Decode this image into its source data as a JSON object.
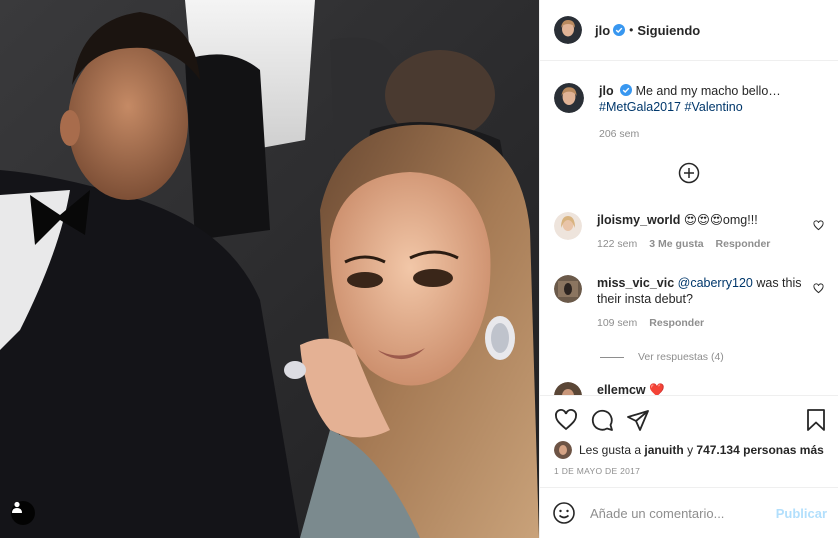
{
  "post": {
    "author": "jlo",
    "follow_status": "Siguiendo",
    "separator": "•"
  },
  "caption": {
    "user": "jlo",
    "text": "Me and my macho bello…",
    "hashtag1": "#MetGala2017",
    "hashtag2": "#Valentino",
    "time": "206 sem"
  },
  "comments": [
    {
      "user": "jloismy_world",
      "text": "😍😍😍omg!!!",
      "time": "122 sem",
      "likes": "3 Me gusta",
      "reply": "Responder"
    },
    {
      "user": "miss_vic_vic",
      "mention": "@caberry120",
      "text": "was this their insta debut?",
      "time": "109 sem",
      "reply": "Responder",
      "view_replies": "Ver respuestas (4)"
    },
    {
      "user": "ellemcw",
      "text": "❤️"
    }
  ],
  "likes": {
    "prefix": "Les gusta a",
    "user": "januith",
    "mid": "y",
    "count": "747.134 personas más"
  },
  "date": "1 DE MAYO DE 2017",
  "composer": {
    "placeholder": "Añade un comentario...",
    "publish": "Publicar"
  },
  "icons": {
    "verified": "verified-badge-icon",
    "add": "plus-circle-icon",
    "like": "heart-icon",
    "comment": "comment-icon",
    "share": "share-icon",
    "save": "bookmark-icon",
    "emoji": "emoji-icon",
    "tag": "user-tag-icon"
  },
  "colors": {
    "verified": "#3897f0",
    "link": "#00376b",
    "muted": "#8e8e8e",
    "publish_disabled": "#b2dffc"
  }
}
